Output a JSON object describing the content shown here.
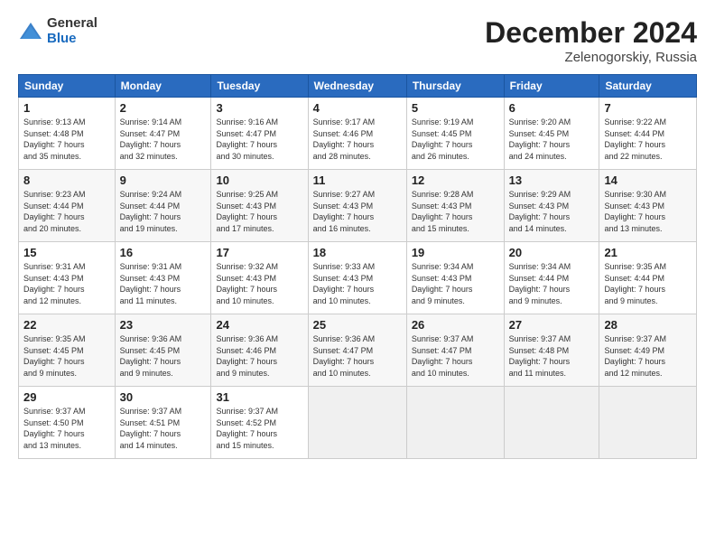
{
  "logo": {
    "general": "General",
    "blue": "Blue"
  },
  "header": {
    "month": "December 2024",
    "location": "Zelenogorskiy, Russia"
  },
  "weekdays": [
    "Sunday",
    "Monday",
    "Tuesday",
    "Wednesday",
    "Thursday",
    "Friday",
    "Saturday"
  ],
  "weeks": [
    [
      {
        "day": 1,
        "info": "Sunrise: 9:13 AM\nSunset: 4:48 PM\nDaylight: 7 hours\nand 35 minutes."
      },
      {
        "day": 2,
        "info": "Sunrise: 9:14 AM\nSunset: 4:47 PM\nDaylight: 7 hours\nand 32 minutes."
      },
      {
        "day": 3,
        "info": "Sunrise: 9:16 AM\nSunset: 4:47 PM\nDaylight: 7 hours\nand 30 minutes."
      },
      {
        "day": 4,
        "info": "Sunrise: 9:17 AM\nSunset: 4:46 PM\nDaylight: 7 hours\nand 28 minutes."
      },
      {
        "day": 5,
        "info": "Sunrise: 9:19 AM\nSunset: 4:45 PM\nDaylight: 7 hours\nand 26 minutes."
      },
      {
        "day": 6,
        "info": "Sunrise: 9:20 AM\nSunset: 4:45 PM\nDaylight: 7 hours\nand 24 minutes."
      },
      {
        "day": 7,
        "info": "Sunrise: 9:22 AM\nSunset: 4:44 PM\nDaylight: 7 hours\nand 22 minutes."
      }
    ],
    [
      {
        "day": 8,
        "info": "Sunrise: 9:23 AM\nSunset: 4:44 PM\nDaylight: 7 hours\nand 20 minutes."
      },
      {
        "day": 9,
        "info": "Sunrise: 9:24 AM\nSunset: 4:44 PM\nDaylight: 7 hours\nand 19 minutes."
      },
      {
        "day": 10,
        "info": "Sunrise: 9:25 AM\nSunset: 4:43 PM\nDaylight: 7 hours\nand 17 minutes."
      },
      {
        "day": 11,
        "info": "Sunrise: 9:27 AM\nSunset: 4:43 PM\nDaylight: 7 hours\nand 16 minutes."
      },
      {
        "day": 12,
        "info": "Sunrise: 9:28 AM\nSunset: 4:43 PM\nDaylight: 7 hours\nand 15 minutes."
      },
      {
        "day": 13,
        "info": "Sunrise: 9:29 AM\nSunset: 4:43 PM\nDaylight: 7 hours\nand 14 minutes."
      },
      {
        "day": 14,
        "info": "Sunrise: 9:30 AM\nSunset: 4:43 PM\nDaylight: 7 hours\nand 13 minutes."
      }
    ],
    [
      {
        "day": 15,
        "info": "Sunrise: 9:31 AM\nSunset: 4:43 PM\nDaylight: 7 hours\nand 12 minutes."
      },
      {
        "day": 16,
        "info": "Sunrise: 9:31 AM\nSunset: 4:43 PM\nDaylight: 7 hours\nand 11 minutes."
      },
      {
        "day": 17,
        "info": "Sunrise: 9:32 AM\nSunset: 4:43 PM\nDaylight: 7 hours\nand 10 minutes."
      },
      {
        "day": 18,
        "info": "Sunrise: 9:33 AM\nSunset: 4:43 PM\nDaylight: 7 hours\nand 10 minutes."
      },
      {
        "day": 19,
        "info": "Sunrise: 9:34 AM\nSunset: 4:43 PM\nDaylight: 7 hours\nand 9 minutes."
      },
      {
        "day": 20,
        "info": "Sunrise: 9:34 AM\nSunset: 4:44 PM\nDaylight: 7 hours\nand 9 minutes."
      },
      {
        "day": 21,
        "info": "Sunrise: 9:35 AM\nSunset: 4:44 PM\nDaylight: 7 hours\nand 9 minutes."
      }
    ],
    [
      {
        "day": 22,
        "info": "Sunrise: 9:35 AM\nSunset: 4:45 PM\nDaylight: 7 hours\nand 9 minutes."
      },
      {
        "day": 23,
        "info": "Sunrise: 9:36 AM\nSunset: 4:45 PM\nDaylight: 7 hours\nand 9 minutes."
      },
      {
        "day": 24,
        "info": "Sunrise: 9:36 AM\nSunset: 4:46 PM\nDaylight: 7 hours\nand 9 minutes."
      },
      {
        "day": 25,
        "info": "Sunrise: 9:36 AM\nSunset: 4:47 PM\nDaylight: 7 hours\nand 10 minutes."
      },
      {
        "day": 26,
        "info": "Sunrise: 9:37 AM\nSunset: 4:47 PM\nDaylight: 7 hours\nand 10 minutes."
      },
      {
        "day": 27,
        "info": "Sunrise: 9:37 AM\nSunset: 4:48 PM\nDaylight: 7 hours\nand 11 minutes."
      },
      {
        "day": 28,
        "info": "Sunrise: 9:37 AM\nSunset: 4:49 PM\nDaylight: 7 hours\nand 12 minutes."
      }
    ],
    [
      {
        "day": 29,
        "info": "Sunrise: 9:37 AM\nSunset: 4:50 PM\nDaylight: 7 hours\nand 13 minutes."
      },
      {
        "day": 30,
        "info": "Sunrise: 9:37 AM\nSunset: 4:51 PM\nDaylight: 7 hours\nand 14 minutes."
      },
      {
        "day": 31,
        "info": "Sunrise: 9:37 AM\nSunset: 4:52 PM\nDaylight: 7 hours\nand 15 minutes."
      },
      null,
      null,
      null,
      null
    ]
  ]
}
